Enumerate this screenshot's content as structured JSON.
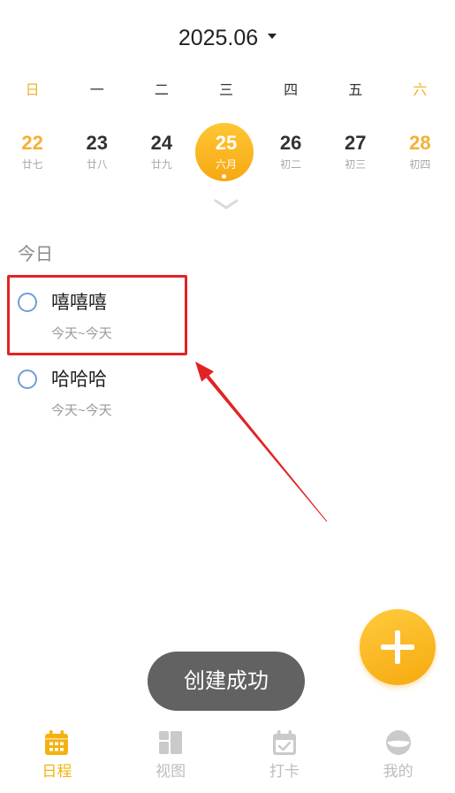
{
  "header": {
    "month_label": "2025.06",
    "dropdown_icon": "caret-down-icon"
  },
  "weekdays": [
    {
      "label": "日",
      "weekend": true
    },
    {
      "label": "一",
      "weekend": false
    },
    {
      "label": "二",
      "weekend": false
    },
    {
      "label": "三",
      "weekend": false
    },
    {
      "label": "四",
      "weekend": false
    },
    {
      "label": "五",
      "weekend": false
    },
    {
      "label": "六",
      "weekend": true
    }
  ],
  "dates": [
    {
      "day": "22",
      "lunar": "廿七",
      "weekend": true,
      "selected": false,
      "has_events": false
    },
    {
      "day": "23",
      "lunar": "廿八",
      "weekend": false,
      "selected": false,
      "has_events": false
    },
    {
      "day": "24",
      "lunar": "廿九",
      "weekend": false,
      "selected": false,
      "has_events": false
    },
    {
      "day": "25",
      "lunar": "六月",
      "weekend": false,
      "selected": true,
      "has_events": true
    },
    {
      "day": "26",
      "lunar": "初二",
      "weekend": false,
      "selected": false,
      "has_events": false
    },
    {
      "day": "27",
      "lunar": "初三",
      "weekend": false,
      "selected": false,
      "has_events": false
    },
    {
      "day": "28",
      "lunar": "初四",
      "weekend": true,
      "selected": false,
      "has_events": false
    }
  ],
  "expand_icon": "chevron-down-icon",
  "today_section": {
    "title": "今日",
    "tasks": [
      {
        "title": "嘻嘻嘻",
        "date_range": "今天~今天",
        "done": false,
        "annotated": true
      },
      {
        "title": "哈哈哈",
        "date_range": "今天~今天",
        "done": false,
        "annotated": false
      }
    ]
  },
  "fab": {
    "icon": "plus-icon"
  },
  "toast": {
    "message": "创建成功"
  },
  "tab_bar": {
    "tabs": [
      {
        "label": "日程",
        "icon": "calendar-icon",
        "active": true
      },
      {
        "label": "视图",
        "icon": "layout-grid-icon",
        "active": false
      },
      {
        "label": "打卡",
        "icon": "check-calendar-icon",
        "active": false
      },
      {
        "label": "我的",
        "icon": "profile-icon",
        "active": false
      }
    ]
  },
  "colors": {
    "accent": "#F5B10F",
    "weekend": "#F2B233",
    "text_primary": "#222222",
    "text_secondary": "#A8A8A8",
    "task_checkbox": "#6F9FD8",
    "tab_inactive": "#CACACA",
    "toast_bg": "#626262",
    "annotation": "#E02424"
  }
}
